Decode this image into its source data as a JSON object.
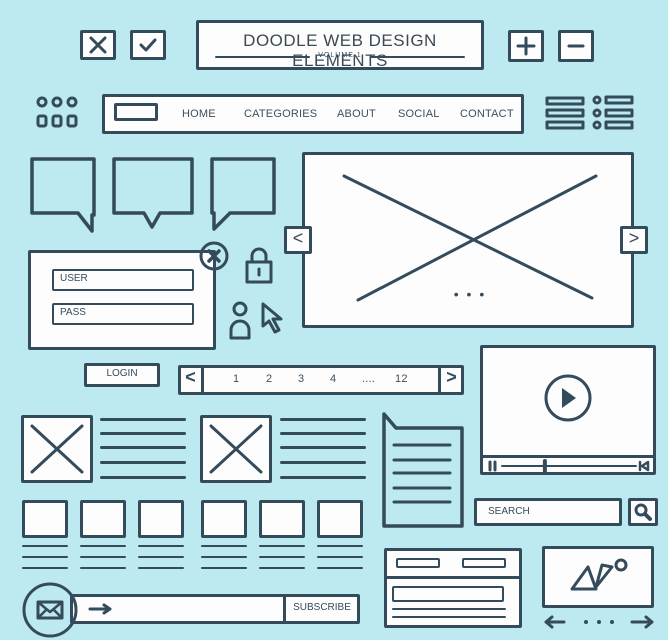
{
  "colors": {
    "background": "#bde9f1",
    "ink": "#344b5c",
    "paper": "#fdfdfd"
  },
  "header": {
    "title": "DOODLE WEB DESIGN ELEMENTS",
    "subtitle": "VOLUME 1"
  },
  "top_icons": [
    {
      "name": "close-icon",
      "glyph": "✕"
    },
    {
      "name": "check-icon",
      "glyph": "✓"
    },
    {
      "name": "plus-icon",
      "glyph": "+"
    },
    {
      "name": "minus-icon",
      "glyph": "−"
    }
  ],
  "navbar": {
    "items": [
      "HOME",
      "CATEGORIES",
      "ABOUT",
      "SOCIAL",
      "CONTACT"
    ]
  },
  "login": {
    "user_placeholder": "USER",
    "pass_placeholder": "PASS",
    "button_label": "LOGIN"
  },
  "pagination": {
    "prev": "<",
    "next": ">",
    "pages": [
      "1",
      "2",
      "3",
      "4",
      "....",
      "12"
    ]
  },
  "slider": {
    "prev": "<",
    "next": ">",
    "dots": "• • •"
  },
  "video": {
    "progress": 0.32
  },
  "search": {
    "placeholder": "SEARCH"
  },
  "subscribe": {
    "button_label": "SUBSCRIBE"
  }
}
